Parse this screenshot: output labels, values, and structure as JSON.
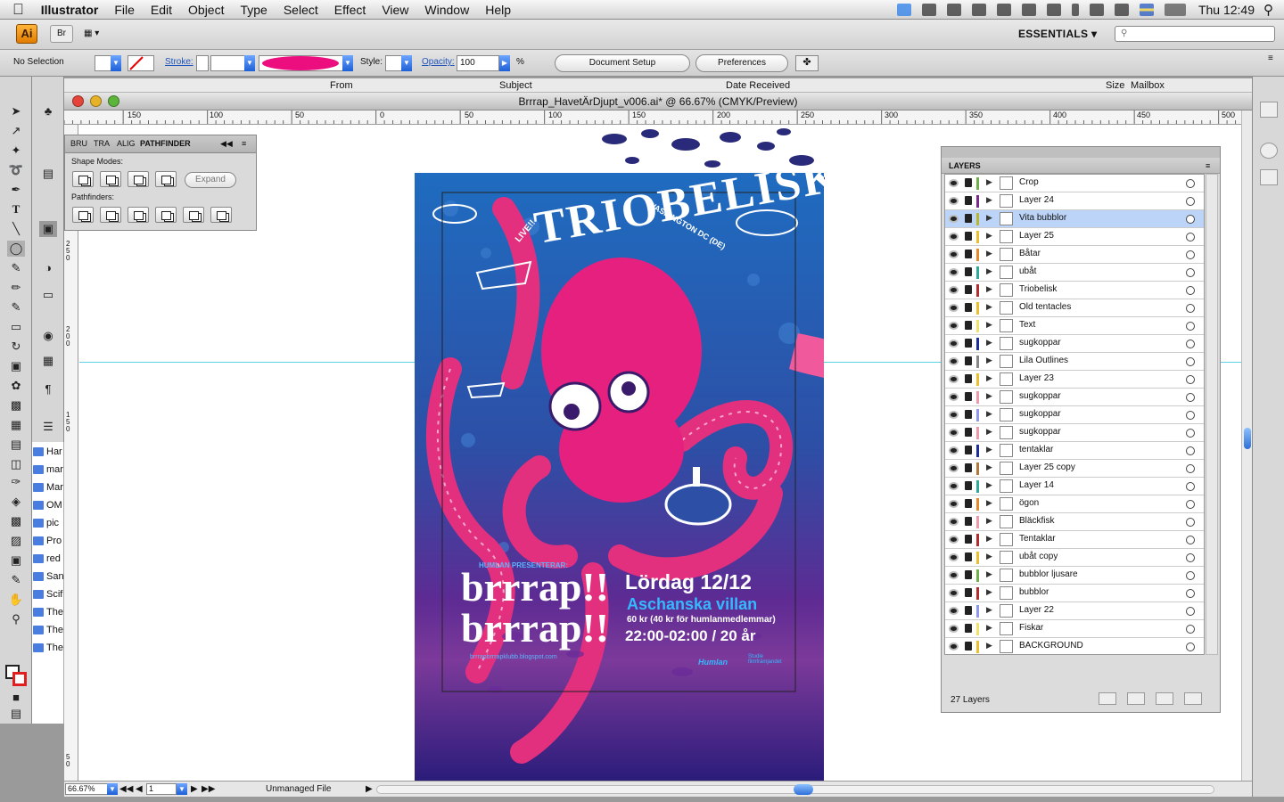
{
  "menubar": {
    "app": "Illustrator",
    "items": [
      "File",
      "Edit",
      "Object",
      "Type",
      "Select",
      "Effect",
      "View",
      "Window",
      "Help"
    ],
    "clock": "Thu 12:49"
  },
  "appbar": {
    "logo": "Ai",
    "bridge": "Br",
    "workspace": "ESSENTIALS"
  },
  "control": {
    "selection": "No Selection",
    "stroke_label": "Stroke:",
    "style_label": "Style:",
    "opacity_label": "Opacity:",
    "opacity_value": "100",
    "percent": "%",
    "doc_setup": "Document Setup",
    "preferences": "Preferences",
    "fill_color": "#ec0d7f"
  },
  "mail": {
    "columns": [
      "From",
      "Subject",
      "Date Received",
      "Size",
      "Mailbox"
    ],
    "list": [
      "Har",
      "mar",
      "Mar",
      "OM",
      "pic",
      "Pro",
      "red",
      "San",
      "Scif",
      "The",
      "The",
      "The"
    ]
  },
  "document": {
    "title": "Brrrap_HavetÄrDjupt_v006.ai* @ 66.67% (CMYK/Preview)",
    "ruler_ticks": [
      "150",
      "100",
      "50",
      "0",
      "50",
      "100",
      "150",
      "200",
      "250",
      "300",
      "350",
      "400",
      "450",
      "500"
    ],
    "vruler_ticks": [
      "250",
      "200",
      "150",
      "50"
    ],
    "zoom": "66.67%",
    "page": "1",
    "status": "Unmanaged File"
  },
  "pathfinder": {
    "tabs": [
      "BRU",
      "TRA",
      "ALIG",
      "PATHFINDER"
    ],
    "shape_modes": "Shape Modes:",
    "pathfinders": "Pathfinders:",
    "expand": "Expand"
  },
  "layers": {
    "title": "LAYERS",
    "footer": "27 Layers",
    "rows": [
      {
        "name": "Crop",
        "color": "#6fb04a"
      },
      {
        "name": "Layer 24",
        "color": "#7a2a8a"
      },
      {
        "name": "Vita bubblor",
        "color": "#b8b62e",
        "selected": true
      },
      {
        "name": "Layer 25",
        "color": "#e9c02d"
      },
      {
        "name": "Båtar",
        "color": "#e48a26"
      },
      {
        "name": "ubåt",
        "color": "#2eaa9b"
      },
      {
        "name": "Triobelisk",
        "color": "#b22e2e"
      },
      {
        "name": "Old tentacles",
        "color": "#e9c02d"
      },
      {
        "name": "Text",
        "color": "#f1e36a"
      },
      {
        "name": "sugkoppar",
        "color": "#1d2d9a"
      },
      {
        "name": "Lila Outlines",
        "color": "#888"
      },
      {
        "name": "Layer 23",
        "color": "#e9c02d"
      },
      {
        "name": "sugkoppar",
        "color": "#ee9aaa"
      },
      {
        "name": "sugkoppar",
        "color": "#8f98ee"
      },
      {
        "name": "sugkoppar",
        "color": "#ee9aaa"
      },
      {
        "name": "tentaklar",
        "color": "#1d2d9a"
      },
      {
        "name": "Layer 25 copy",
        "color": "#b07a3a"
      },
      {
        "name": "Layer 14",
        "color": "#2eaa9b"
      },
      {
        "name": "ögon",
        "color": "#e48a26"
      },
      {
        "name": "Bläckfisk",
        "color": "#ee9aaa"
      },
      {
        "name": "Tentaklar",
        "color": "#b22e2e"
      },
      {
        "name": "ubåt copy",
        "color": "#e9c02d"
      },
      {
        "name": "bubblor ljusare",
        "color": "#6fb04a"
      },
      {
        "name": "bubblor",
        "color": "#b22e2e"
      },
      {
        "name": "Layer 22",
        "color": "#8f98ee"
      },
      {
        "name": "Fiskar",
        "color": "#f1e36a"
      },
      {
        "name": "BACKGROUND",
        "color": "#e9c02d"
      }
    ]
  },
  "poster": {
    "title": "TRIOBELISK",
    "live": "LIVE!!",
    "subtitle": "WASHINGTON DC (DE)",
    "presenter": "HUMLAN PRESENTERAR:",
    "brrrap1": "brrrap!!",
    "brrrap2": "brrrap!!",
    "url": "brrrapbrrrapklubb.blogspot.com",
    "date": "Lördag 12/12",
    "venue": "Aschanska villan",
    "price": "60 kr (40 kr för humlanmedlemmar)",
    "time": "22:00-02:00 / 20 år",
    "logo1": "Humlan",
    "logo2": "Studie filmfrämjandet"
  }
}
